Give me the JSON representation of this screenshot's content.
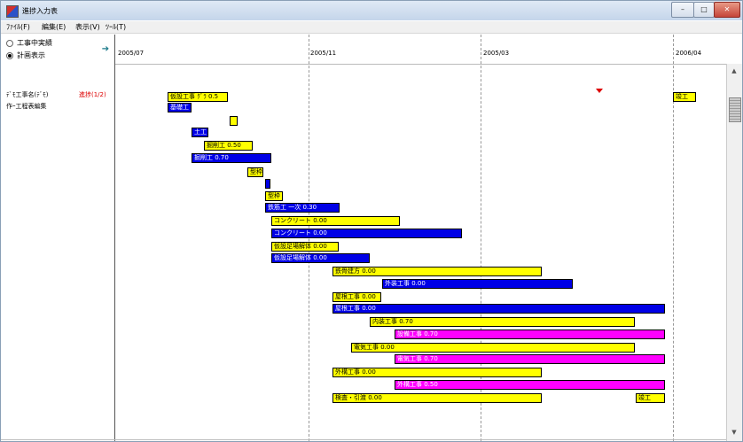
{
  "window": {
    "title": "進捗入力表"
  },
  "menu": [
    "ﾌｧｲﾙ(F)",
    "編集(E)",
    "表示(V)",
    "ﾂｰﾙ(T)"
  ],
  "mode": {
    "options": [
      "工事中実績",
      "計画表示"
    ],
    "selected_index": 1
  },
  "header": {
    "dates": [
      "2005/07",
      "2005/11",
      "2005/03",
      "2006/04"
    ]
  },
  "left_labels": {
    "project": "ﾃﾞﾓ工事名(ﾃﾞﾓ)",
    "status": "進捗(1/2)",
    "sub": "作ｰ工程表編集"
  },
  "bars": [
    {
      "label": "仮設工事 ｸﾞﾗ 0.5",
      "color": "y"
    },
    {
      "label": "基礎工",
      "color": "b"
    },
    {
      "label": "",
      "color": "y"
    },
    {
      "label": "土工",
      "color": "b"
    },
    {
      "label": "掘削工 0.50",
      "color": "y"
    },
    {
      "label": "掘削工 0.70",
      "color": "b"
    },
    {
      "label": "型枠",
      "color": "y"
    },
    {
      "label": "",
      "color": "b"
    },
    {
      "label": "型枠",
      "color": "y"
    },
    {
      "label": "鉄筋工 一次 0.30",
      "color": "b"
    },
    {
      "label": "コンクリート 0.00",
      "color": "y"
    },
    {
      "label": "コンクリート 0.00",
      "color": "b"
    },
    {
      "label": "仮設足場解体 0.00",
      "color": "y"
    },
    {
      "label": "仮設足場解体 0.00",
      "color": "b"
    },
    {
      "label": "鉄骨建方 0.00",
      "color": "y"
    },
    {
      "label": "外装工事 0.00",
      "color": "b"
    },
    {
      "label": "屋根工事 0.00",
      "color": "y"
    },
    {
      "label": "屋根工事 0.00",
      "color": "b"
    },
    {
      "label": "内装工事 0.70",
      "color": "y"
    },
    {
      "label": "設備工事 0.70",
      "color": "m"
    },
    {
      "label": "電気工事 0.00",
      "color": "y"
    },
    {
      "label": "電気工事 0.70",
      "color": "m"
    },
    {
      "label": "外構工事 0.00",
      "color": "y"
    },
    {
      "label": "外構工事 0.50",
      "color": "m"
    },
    {
      "label": "検査・引渡 0.00",
      "color": "y"
    },
    {
      "label": "竣工",
      "color": "y"
    },
    {
      "label": "竣工",
      "color": "y"
    }
  ],
  "colors": {
    "plan": "#ffff00",
    "actual": "#0000e6",
    "progress": "#ff00ff",
    "marker": "#dd0000"
  }
}
